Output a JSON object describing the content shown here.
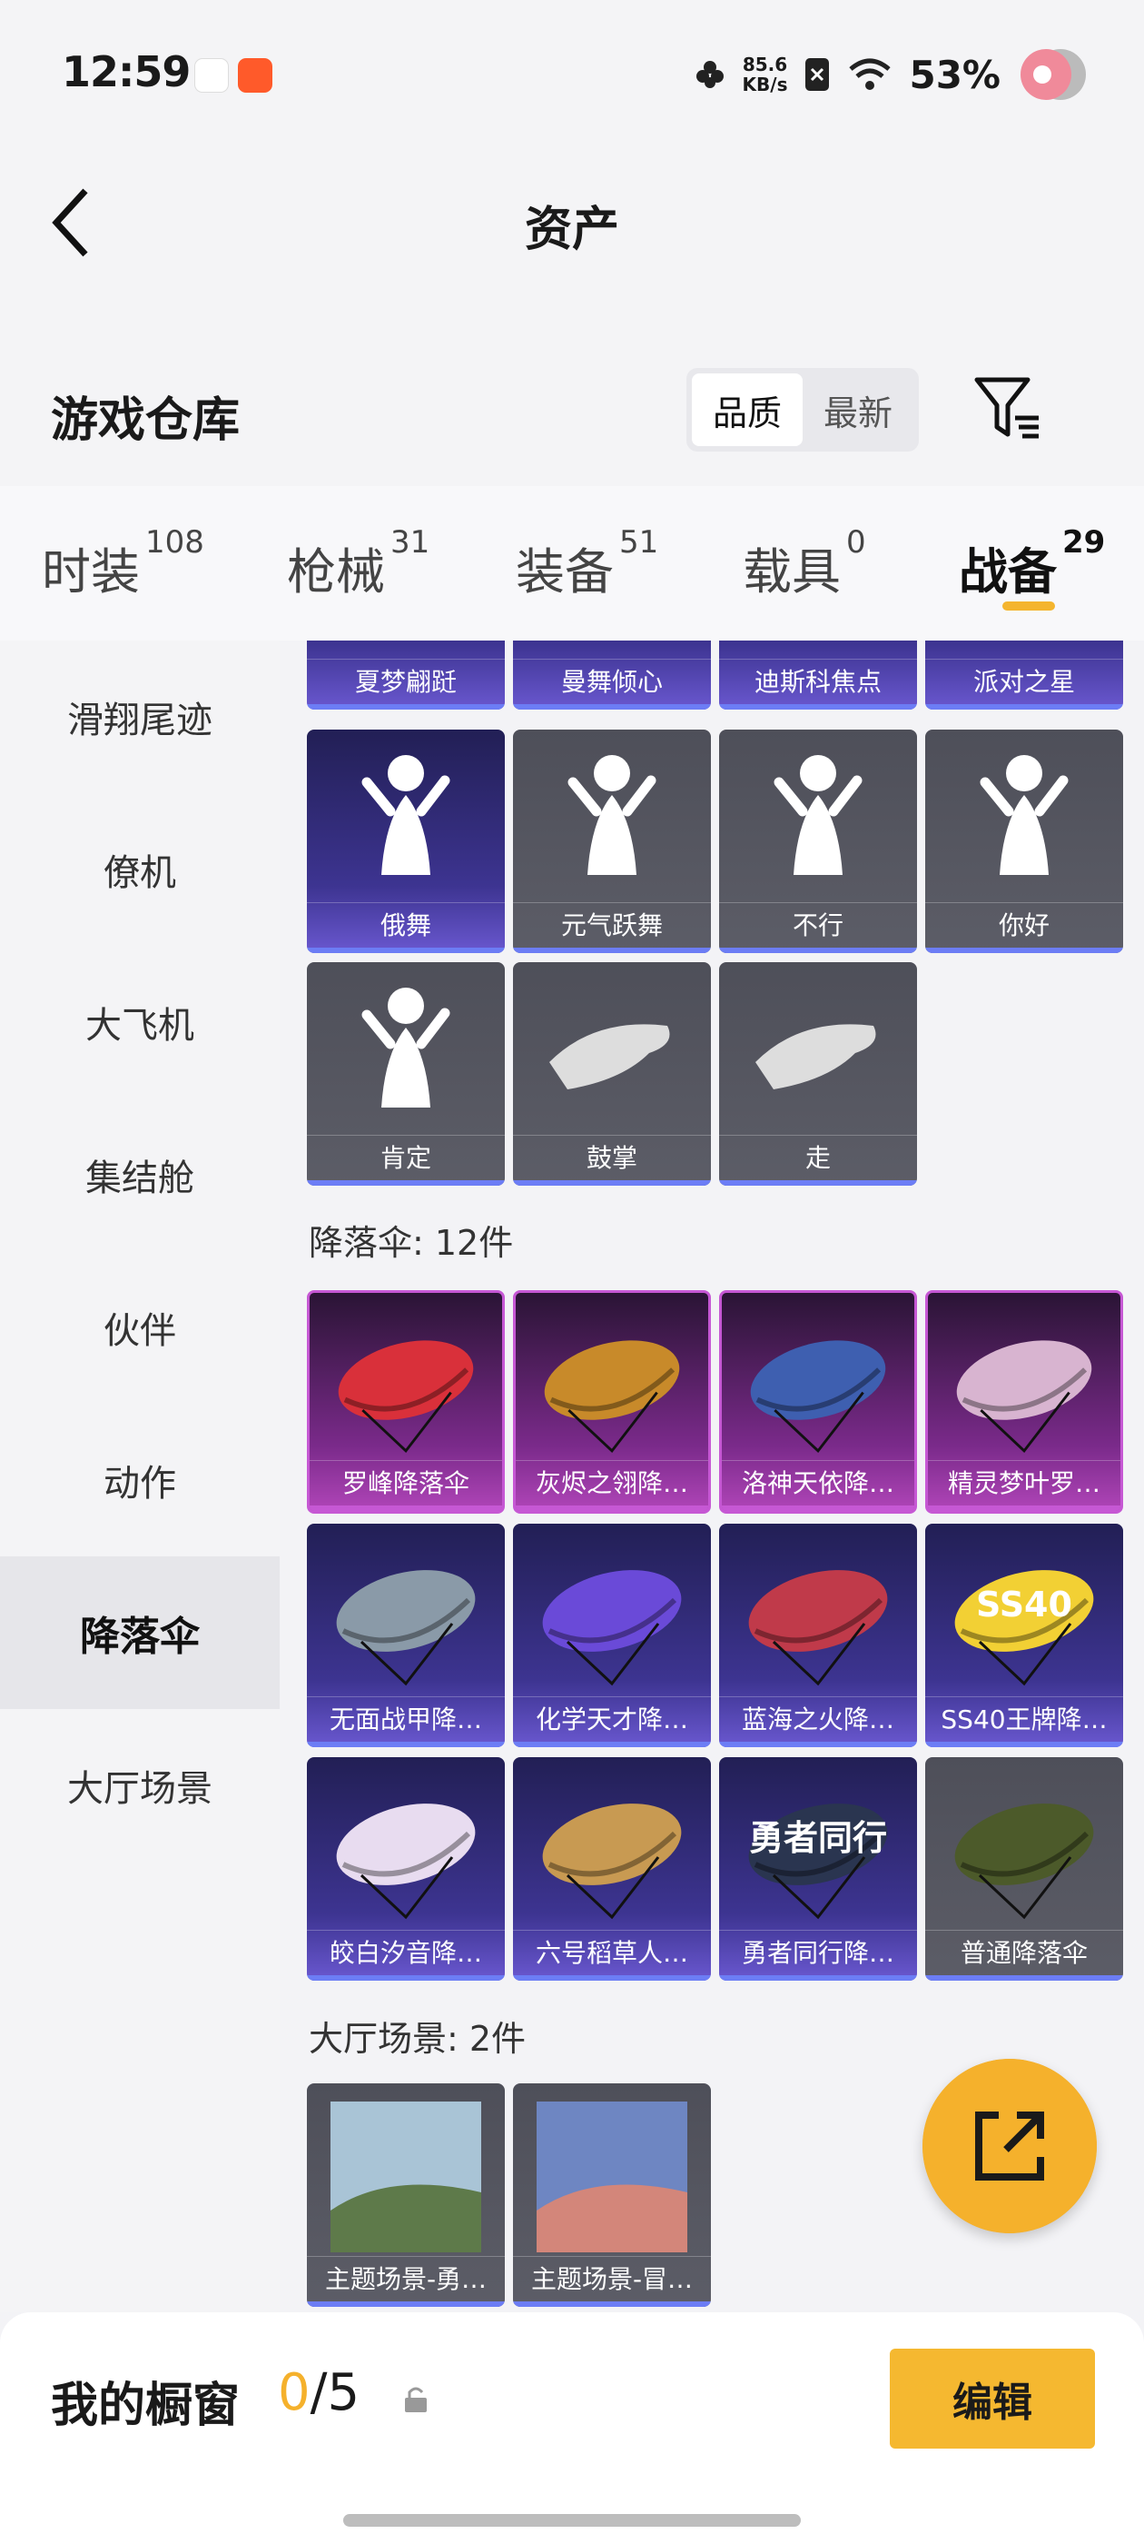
{
  "status_bar": {
    "time": "12:59",
    "net_speed_value": "85.6",
    "net_speed_unit": "KB/s",
    "battery": "53%"
  },
  "header": {
    "title": "资产"
  },
  "warehouse": {
    "title": "游戏仓库",
    "sort_options": [
      "品质",
      "最新"
    ],
    "sort_selected": "品质"
  },
  "tabs": [
    {
      "label": "时装",
      "count": "108"
    },
    {
      "label": "枪械",
      "count": "31"
    },
    {
      "label": "装备",
      "count": "51"
    },
    {
      "label": "载具",
      "count": "0"
    },
    {
      "label": "战备",
      "count": "29",
      "active": true
    }
  ],
  "sidebar": {
    "items": [
      "滑翔尾迹",
      "僚机",
      "大飞机",
      "集结舱",
      "伙伴",
      "动作",
      "降落伞",
      "大厅场景"
    ],
    "active": "降落伞"
  },
  "actions_partial": {
    "items": [
      "夏梦翩跹",
      "曼舞倾心",
      "迪斯科焦点",
      "派对之星"
    ]
  },
  "actions_main": {
    "items": [
      "俄舞",
      "元气跃舞",
      "不行",
      "你好",
      "肯定",
      "鼓掌",
      "走"
    ]
  },
  "parachutes": {
    "header": "降落伞: 12件",
    "items": [
      "罗峰降落伞",
      "灰烬之翎降…",
      "洛神天依降…",
      "精灵梦叶罗…",
      "无面战甲降…",
      "化学天才降…",
      "蓝海之火降…",
      "SS40王牌降…",
      "皎白汐音降…",
      "六号稻草人…",
      "勇者同行降…",
      "普通降落伞"
    ],
    "tiers": [
      "mag",
      "mag",
      "mag",
      "mag",
      "purple",
      "purple",
      "purple",
      "purple",
      "purple",
      "purple",
      "purple",
      "grey"
    ],
    "colors": [
      "#d9303a",
      "#c88a2a",
      "#3e5fb0",
      "#d8b4d0",
      "#8a9aa8",
      "#6a4ad8",
      "#c03a4a",
      "#f2d034",
      "#e8dcf0",
      "#c89a52",
      "#2a3550",
      "#4c5a2a"
    ],
    "art_texts": [
      "",
      "",
      "",
      "",
      "",
      "",
      "",
      "SS40",
      "",
      "",
      "勇者同行",
      ""
    ]
  },
  "lobby": {
    "header": "大厅场景: 2件",
    "items": [
      "主题场景-勇…",
      "主题场景-冒…"
    ]
  },
  "bottom_bar": {
    "label": "我的橱窗",
    "current": "0",
    "total": "/5",
    "edit_label": "编辑"
  },
  "icons": [
    "back-arrow-icon",
    "filter-icon",
    "share-icon",
    "lock-icon",
    "wifi-icon",
    "flower-icon",
    "sim-icon"
  ]
}
